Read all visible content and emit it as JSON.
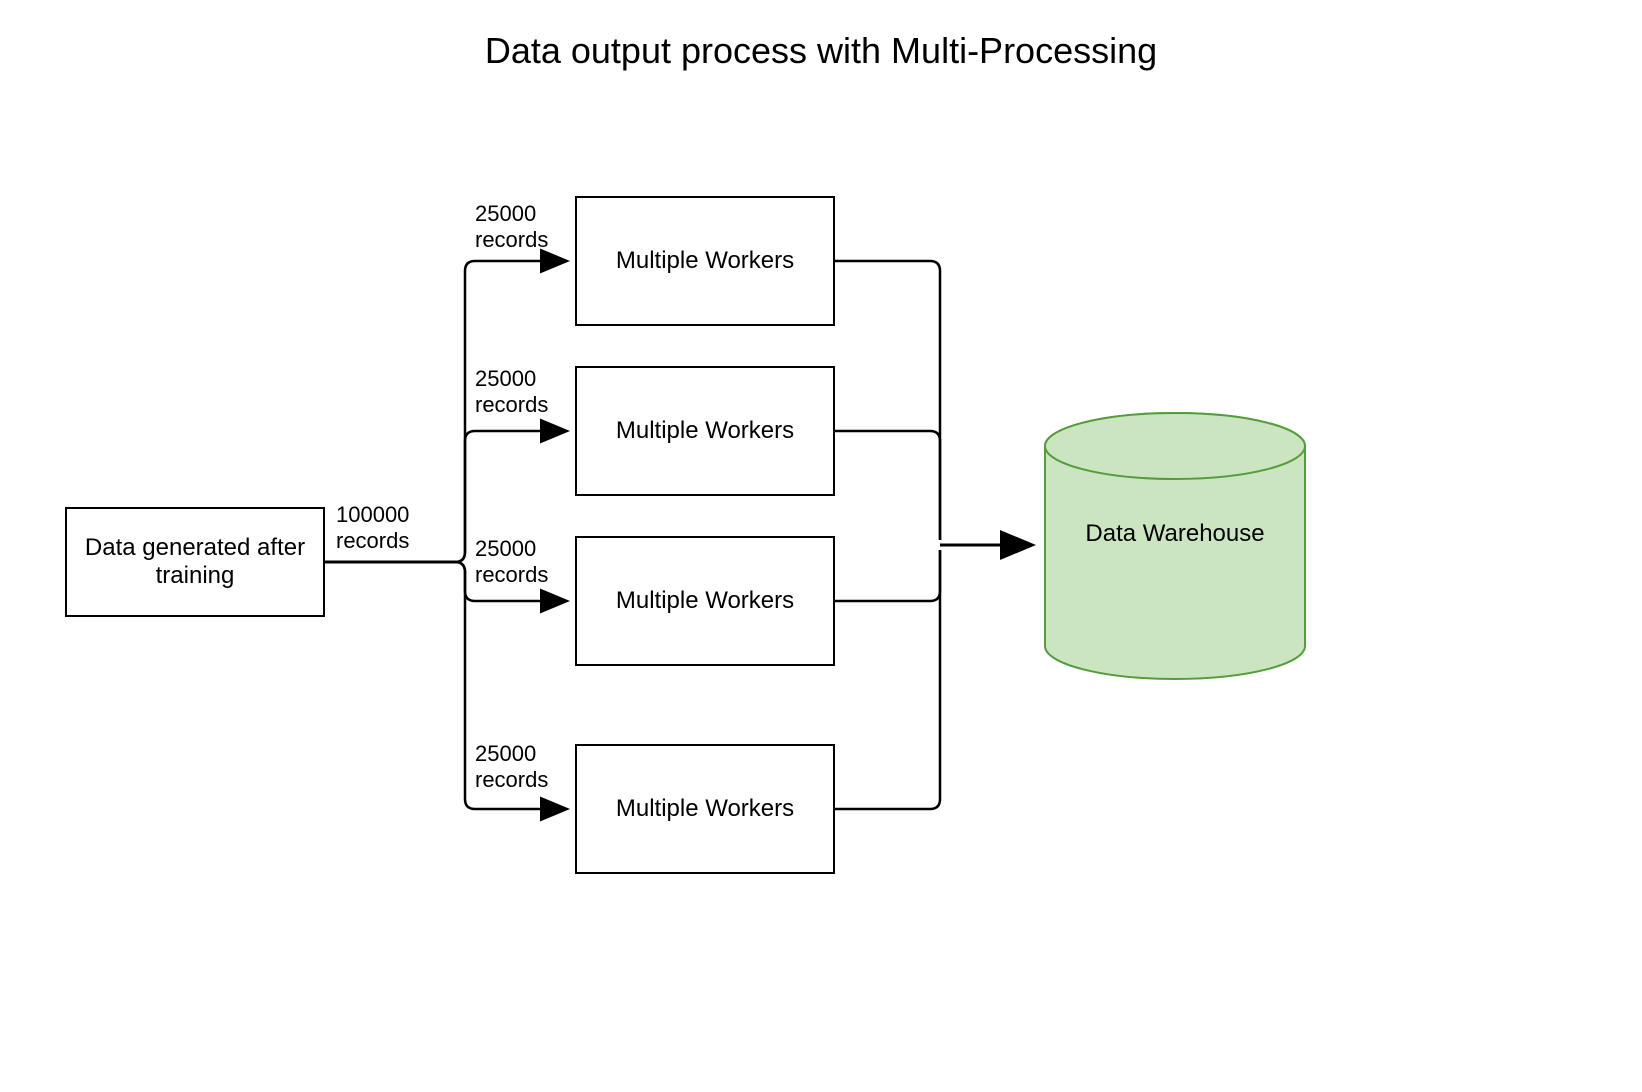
{
  "title": "Data output process with Multi-Processing",
  "source": {
    "label": "Data generated after training"
  },
  "main_edge_label": "100000\nrecords",
  "worker_edge_label": "25000\nrecords",
  "workers": [
    {
      "label": "Multiple Workers"
    },
    {
      "label": "Multiple Workers"
    },
    {
      "label": "Multiple Workers"
    },
    {
      "label": "Multiple Workers"
    }
  ],
  "destination": {
    "label": "Data Warehouse"
  },
  "colors": {
    "cylinder_fill": "#cce5c1",
    "cylinder_stroke": "#539e3b",
    "line": "#000000"
  }
}
